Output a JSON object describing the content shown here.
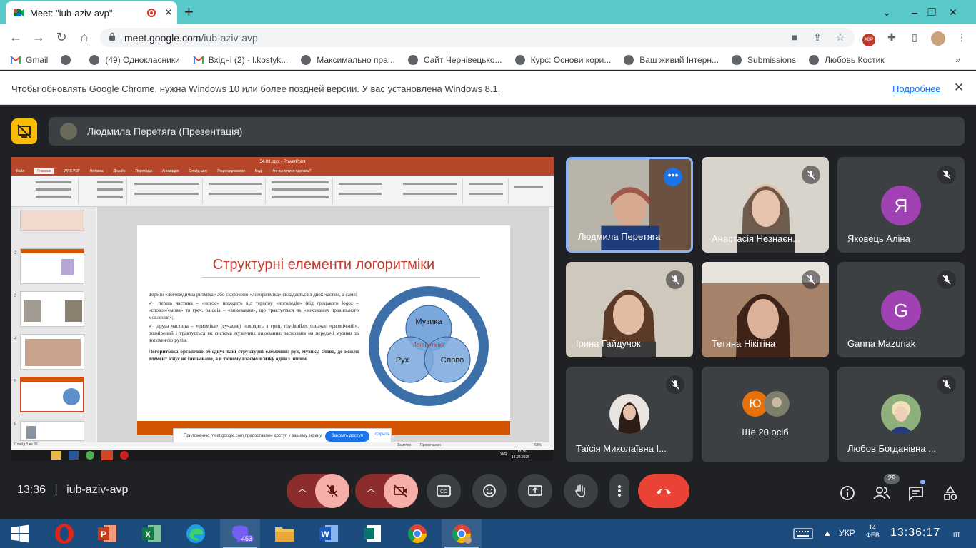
{
  "browser": {
    "tab_title": "Meet: \"iub-aziv-avp\"",
    "url_host": "meet.google.com",
    "url_path": "/iub-aziv-avp"
  },
  "bookmarks": [
    {
      "label": "Gmail",
      "icon": "gmail-icon"
    },
    {
      "label": "",
      "icon": "globe-icon"
    },
    {
      "label": "(49) Однокласники",
      "icon": "globe-icon"
    },
    {
      "label": "Вхідні (2) - l.kostyk...",
      "icon": "gmail-icon"
    },
    {
      "label": "Максимально пра...",
      "icon": "globe-icon"
    },
    {
      "label": "Сайт Чернівецько...",
      "icon": "globe-icon"
    },
    {
      "label": "Курс: Основи кори...",
      "icon": "globe-icon"
    },
    {
      "label": "Ваш живий Інтерн...",
      "icon": "globe-icon"
    },
    {
      "label": "Submissions",
      "icon": "globe-icon"
    },
    {
      "label": "Любовь Костик",
      "icon": "globe-icon"
    }
  ],
  "infobar": {
    "message": "Чтобы обновлять Google Chrome, нужна Windows 10 или более поздней версии. У вас установлена Windows 8.1.",
    "link": "Подробнее"
  },
  "presentation": {
    "presenter_label": "Людмила Перетяга (Презентація)"
  },
  "shared_screen": {
    "ppt_title": "54.03.pptx - PowerPoint",
    "ppt_tabs": [
      "Файл",
      "Главная",
      "WPS PDF",
      "Вставка",
      "Дизайн",
      "Переходы",
      "Анимация",
      "Слайд-шоу",
      "Рецензирование",
      "Вид",
      "Что вы хотите сделать?"
    ],
    "slide_title": "Структурні елементи логоритміки",
    "paragraphs": [
      "Термін «логопедична ритміка» або скорочено «логоритміка» складається з двох частин, а саме:",
      "✓ перша частина – «логос» походить від терміну «логоледія» (від грецького logos – «слово»/«мова» та греч. paideia – «виховання», що трактується як «виховання правильного мовлення»;",
      "✓ друга частина – «ритміка» (сучасне) походить з грец. rhythmikos означає «ритмічний», розмірений і трактується як система музичних виховання, заснована на передачі музики за допомогою рухів."
    ],
    "bold_paragraph": "Логоритміка органічно об'єднує такі структурні елементи: рух, музику, слово, де кожен елемент існує не ізольовано, а в тісному взаємозв'язку один з іншим.",
    "diagram": {
      "top": "Музика",
      "left": "Рух",
      "right": "Слово",
      "center": "Логоритміка"
    },
    "popup_text": "Приложению meet.google.com предоставлен доступ к вашему экрану.",
    "popup_button": "Закрыть доступ",
    "popup_hide": "Скрыть",
    "thumb_numbers": [
      "",
      "2",
      "3",
      "4",
      "5",
      "6"
    ],
    "status_left": "Слайд 5 из 36",
    "status_notes": "Заметки",
    "status_comments": "Примечания",
    "status_zoom": "63%",
    "tray_time": "13:36",
    "tray_date": "14.02.2025",
    "tray_lang": "УКР"
  },
  "participants": [
    {
      "name": "Людмила Перетяга",
      "type": "video",
      "active": true,
      "muted": false
    },
    {
      "name": "Анастасія Незнаєн...",
      "type": "video",
      "muted": true
    },
    {
      "name": "Яковець Аліна",
      "type": "letter",
      "letter": "Я",
      "color": "#a142b4",
      "muted": true
    },
    {
      "name": "Ірина Гайдучок",
      "type": "video",
      "muted": true
    },
    {
      "name": "Тетяна Нікітіна",
      "type": "video",
      "muted": true
    },
    {
      "name": "Ganna Mazuriak",
      "type": "letter",
      "letter": "G",
      "color": "#a142b4",
      "muted": true
    },
    {
      "name": "Таїсія Миколаївна І...",
      "type": "photo",
      "muted": true
    },
    {
      "name": "Ще 20 осіб",
      "type": "more",
      "letter": "Ю"
    },
    {
      "name": "Любов Богданівна ...",
      "type": "photo",
      "muted": true
    }
  ],
  "bottombar": {
    "time": "13:36",
    "separator": "|",
    "meeting_code": "iub-aziv-avp",
    "people_count": "29"
  },
  "windows": {
    "viber_badge": "453",
    "lang": "УКР",
    "date_short": "14 ФЕВ",
    "time": "13:36:17",
    "day": "пт"
  },
  "colors": {
    "accent": "#58c9c8",
    "meet_bg": "#202124",
    "end_call": "#ea4335",
    "present_yellow": "#fbbc04"
  }
}
